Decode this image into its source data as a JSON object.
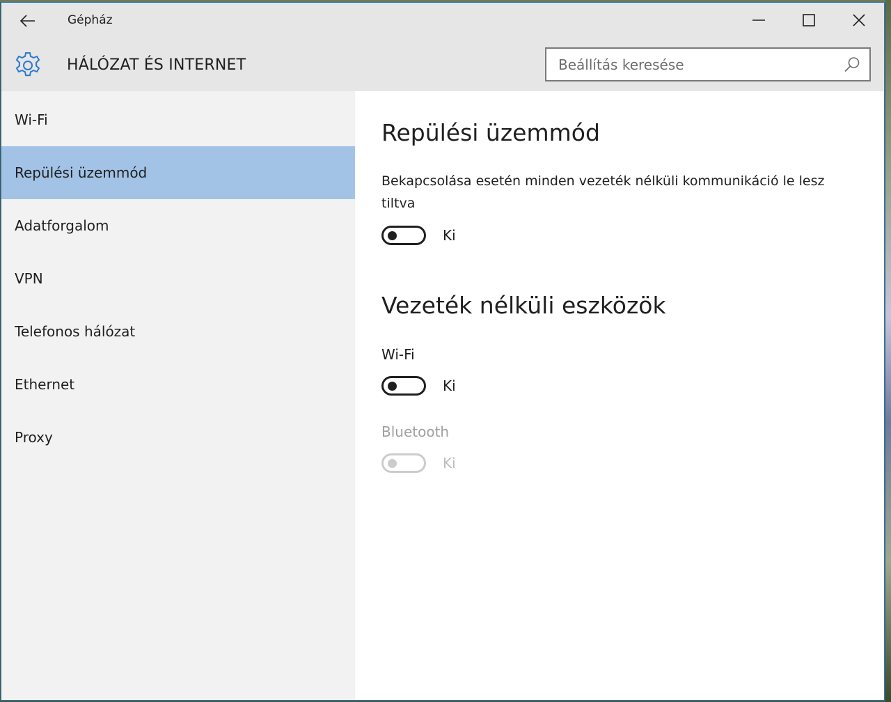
{
  "window": {
    "title": "Gépház",
    "back_icon": "back-arrow-icon",
    "minimize_icon": "minimize-icon",
    "maximize_icon": "maximize-icon",
    "close_icon": "close-icon"
  },
  "header": {
    "icon": "gear-icon",
    "section_title": "HÁLÓZAT ÉS INTERNET",
    "search_placeholder": "Beállítás keresése",
    "search_value": ""
  },
  "sidebar": {
    "selected_index": 1,
    "items": [
      {
        "label": "Wi-Fi"
      },
      {
        "label": "Repülési üzemmód"
      },
      {
        "label": "Adatforgalom"
      },
      {
        "label": "VPN"
      },
      {
        "label": "Telefonos hálózat"
      },
      {
        "label": "Ethernet"
      },
      {
        "label": "Proxy"
      }
    ]
  },
  "main": {
    "airplane": {
      "heading": "Repülési üzemmód",
      "description": "Bekapcsolása esetén minden vezeték nélküli kommunikáció le lesz tiltva",
      "toggle_on": false,
      "state_label": "Ki"
    },
    "wireless": {
      "heading": "Vezeték nélküli eszközök",
      "wifi": {
        "label": "Wi-Fi",
        "toggle_on": false,
        "state_label": "Ki",
        "enabled": true
      },
      "bluetooth": {
        "label": "Bluetooth",
        "toggle_on": false,
        "state_label": "Ki",
        "enabled": false
      }
    }
  },
  "colors": {
    "selected_nav": "#a2c3e6",
    "accent": "#2b79d0",
    "header_bg": "#e6e6e6",
    "sidebar_bg": "#f2f2f2"
  }
}
